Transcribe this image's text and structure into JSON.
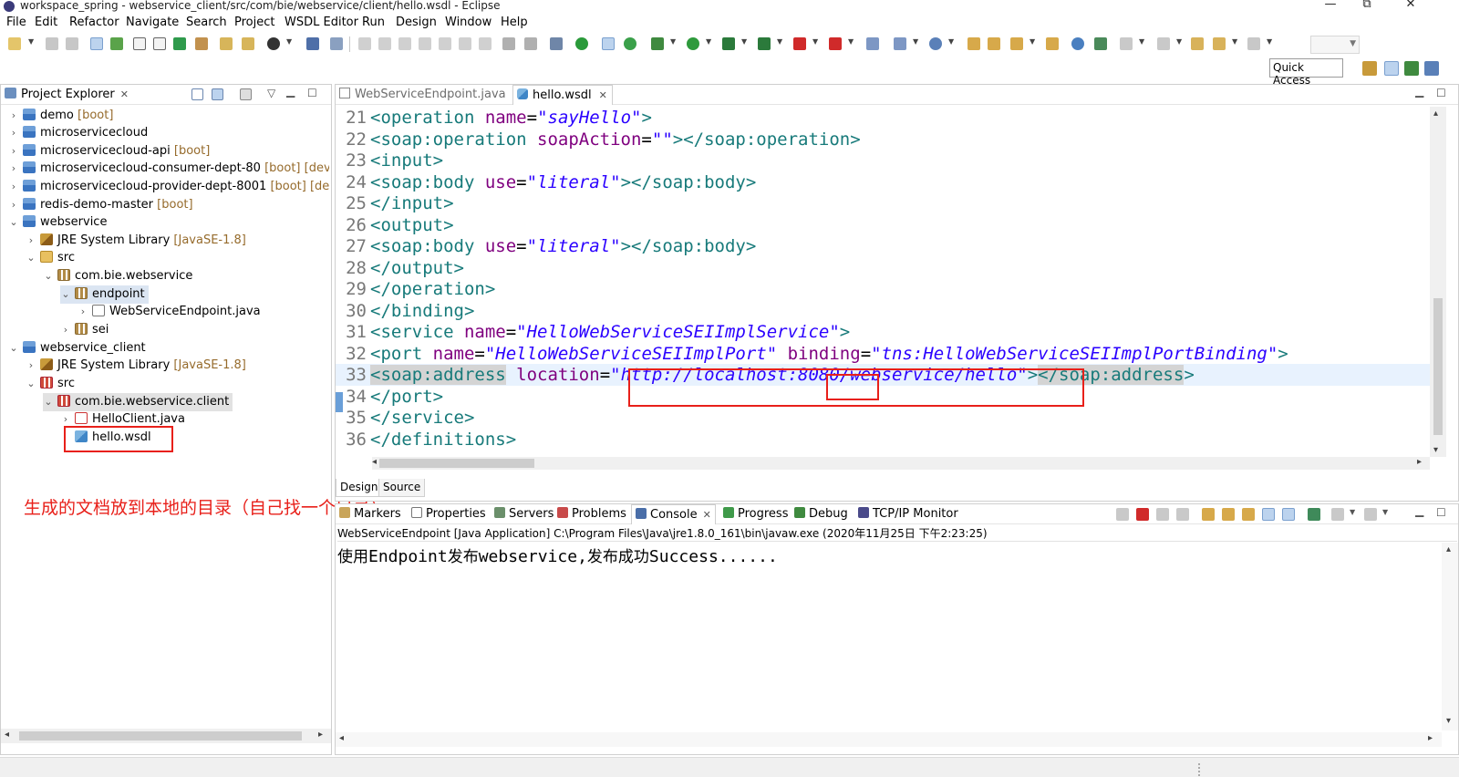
{
  "window": {
    "title": "workspace_spring - webservice_client/src/com/bie/webservice/client/hello.wsdl - Eclipse",
    "controls": {
      "minimize": "—",
      "maximize": "⧉",
      "close": "✕"
    }
  },
  "menu": [
    "File",
    "Edit",
    "Refactor",
    "Navigate",
    "Search",
    "Project",
    "WSDL Editor",
    "Run",
    "Design",
    "Window",
    "Help"
  ],
  "quick_access": {
    "label": "Quick Access"
  },
  "project_explorer": {
    "tab_label": "Project Explorer",
    "close_glyph": "✕",
    "items": [
      {
        "twisty": "›",
        "icon": "project-icon",
        "label": "demo",
        "deco": "[boot]"
      },
      {
        "twisty": "›",
        "icon": "project-icon",
        "label": "microservicecloud",
        "deco": ""
      },
      {
        "twisty": "›",
        "icon": "project-icon",
        "label": "microservicecloud-api",
        "deco": "[boot]"
      },
      {
        "twisty": "›",
        "icon": "project-icon",
        "label": "microservicecloud-consumer-dept-80",
        "deco": "[boot] [devtools]"
      },
      {
        "twisty": "›",
        "icon": "project-icon",
        "label": "microservicecloud-provider-dept-8001",
        "deco": "[boot] [devtools]"
      },
      {
        "twisty": "›",
        "icon": "project-icon",
        "label": "redis-demo-master",
        "deco": "[boot]"
      },
      {
        "twisty": "⌄",
        "icon": "project-icon",
        "label": "webservice",
        "deco": ""
      },
      {
        "twisty": "›",
        "icon": "jre-library-icon",
        "label": "JRE System Library",
        "deco": "[JavaSE-1.8]"
      },
      {
        "twisty": "⌄",
        "icon": "source-folder-icon",
        "label": "src",
        "deco": ""
      },
      {
        "twisty": "⌄",
        "icon": "package-icon",
        "label": "com.bie.webservice",
        "deco": ""
      },
      {
        "twisty": "⌄",
        "icon": "package-icon",
        "label": "endpoint",
        "deco": ""
      },
      {
        "twisty": "›",
        "icon": "java-file-icon",
        "label": "WebServiceEndpoint.java",
        "deco": ""
      },
      {
        "twisty": "›",
        "icon": "package-icon",
        "label": "sei",
        "deco": ""
      },
      {
        "twisty": "⌄",
        "icon": "project-icon",
        "label": "webservice_client",
        "deco": ""
      },
      {
        "twisty": "›",
        "icon": "jre-library-icon",
        "label": "JRE System Library",
        "deco": "[JavaSE-1.8]"
      },
      {
        "twisty": "⌄",
        "icon": "source-folder-icon",
        "label": "src",
        "deco": ""
      },
      {
        "twisty": "⌄",
        "icon": "package-icon",
        "label": "com.bie.webservice.client",
        "deco": ""
      },
      {
        "twisty": "›",
        "icon": "java-file-icon",
        "label": "HelloClient.java",
        "deco": ""
      },
      {
        "twisty": "",
        "icon": "wsdl-file-icon",
        "label": "hello.wsdl",
        "deco": ""
      }
    ]
  },
  "annotation_note": "生成的文档放到本地的目录（自己找一个目录）",
  "editor": {
    "tabs": [
      {
        "label": "WebServiceEndpoint.java",
        "active": false
      },
      {
        "label": "hello.wsdl",
        "active": true
      }
    ],
    "close_glyph": "✕",
    "lines": [
      {
        "n": "21",
        "segs": [
          [
            "t",
            "<operation "
          ],
          [
            "a",
            "name"
          ],
          [
            "p",
            "="
          ],
          [
            "v",
            "\"sayHello\""
          ],
          [
            "t",
            ">"
          ]
        ]
      },
      {
        "n": "22",
        "segs": [
          [
            "t",
            "<soap:operation "
          ],
          [
            "a",
            "soapAction"
          ],
          [
            "p",
            "="
          ],
          [
            "v",
            "\"\""
          ],
          [
            "t",
            "></soap:operation>"
          ]
        ]
      },
      {
        "n": "23",
        "segs": [
          [
            "t",
            "<input>"
          ]
        ]
      },
      {
        "n": "24",
        "segs": [
          [
            "t",
            "<soap:body "
          ],
          [
            "a",
            "use"
          ],
          [
            "p",
            "="
          ],
          [
            "v",
            "\"literal\""
          ],
          [
            "t",
            "></soap:body>"
          ]
        ]
      },
      {
        "n": "25",
        "segs": [
          [
            "t",
            "</input>"
          ]
        ]
      },
      {
        "n": "26",
        "segs": [
          [
            "t",
            "<output>"
          ]
        ]
      },
      {
        "n": "27",
        "segs": [
          [
            "t",
            "<soap:body "
          ],
          [
            "a",
            "use"
          ],
          [
            "p",
            "="
          ],
          [
            "v",
            "\"literal\""
          ],
          [
            "t",
            "></soap:body>"
          ]
        ]
      },
      {
        "n": "28",
        "segs": [
          [
            "t",
            "</output>"
          ]
        ]
      },
      {
        "n": "29",
        "segs": [
          [
            "t",
            "</operation>"
          ]
        ]
      },
      {
        "n": "30",
        "segs": [
          [
            "t",
            "</binding>"
          ]
        ]
      },
      {
        "n": "31",
        "segs": [
          [
            "t",
            "<service "
          ],
          [
            "a",
            "name"
          ],
          [
            "p",
            "="
          ],
          [
            "v",
            "\"HelloWebServiceSEIImplService\""
          ],
          [
            "t",
            ">"
          ]
        ]
      },
      {
        "n": "32",
        "segs": [
          [
            "t",
            "<port "
          ],
          [
            "a",
            "name"
          ],
          [
            "p",
            "="
          ],
          [
            "v",
            "\"HelloWebServiceSEIImplPort\""
          ],
          [
            "p",
            " "
          ],
          [
            "a",
            "binding"
          ],
          [
            "p",
            "="
          ],
          [
            "v",
            "\"tns:HelloWebServiceSEIImplPortBinding\""
          ],
          [
            "t",
            ">"
          ]
        ]
      },
      {
        "n": "33",
        "segs": [
          [
            "h",
            "<soap:address"
          ],
          [
            "p",
            " "
          ],
          [
            "a",
            "location"
          ],
          [
            "p",
            "="
          ],
          [
            "v",
            "\"http://localhost:8080/webservice/hello\""
          ],
          [
            "t",
            ">"
          ],
          [
            "h",
            "</soap:address"
          ],
          [
            "t",
            ">"
          ]
        ]
      },
      {
        "n": "34",
        "segs": [
          [
            "t",
            "</port>"
          ]
        ]
      },
      {
        "n": "35",
        "segs": [
          [
            "t",
            "</service>"
          ]
        ]
      },
      {
        "n": "36",
        "segs": [
          [
            "t",
            "</definitions>"
          ]
        ]
      }
    ],
    "current_line": "33",
    "design_tabs": [
      {
        "label": "Design",
        "active": true
      },
      {
        "label": "Source",
        "active": false
      }
    ]
  },
  "bottom_views": {
    "tabs": [
      {
        "label": "Markers",
        "icon": "markers-icon",
        "active": false
      },
      {
        "label": "Properties",
        "icon": "properties-icon",
        "active": false
      },
      {
        "label": "Servers",
        "icon": "servers-icon",
        "active": false
      },
      {
        "label": "Problems",
        "icon": "problems-icon",
        "active": false
      },
      {
        "label": "Console",
        "icon": "console-icon",
        "active": true
      },
      {
        "label": "Progress",
        "icon": "progress-icon",
        "active": false
      },
      {
        "label": "Debug",
        "icon": "debug-icon",
        "active": false
      },
      {
        "label": "TCP/IP Monitor",
        "icon": "tcpip-monitor-icon",
        "active": false
      }
    ],
    "console": {
      "status": "WebServiceEndpoint [Java Application] C:\\Program Files\\Java\\jre1.8.0_161\\bin\\javaw.exe (2020年11月25日 下午2:23:25)",
      "output_parts": [
        {
          "text": "使用",
          "mono": false
        },
        {
          "text": "Endpoint",
          "mono": true
        },
        {
          "text": "发布",
          "mono": false
        },
        {
          "text": "webservice,",
          "mono": true
        },
        {
          "text": "发布成功",
          "mono": false
        },
        {
          "text": "Success......",
          "mono": true
        }
      ]
    }
  },
  "colors": {
    "accent_red": "#e8201a",
    "xml_tag": "#177a7a",
    "xml_attr": "#7f007f",
    "xml_value": "#2a00ff",
    "current_line_bg": "#e8f2fe"
  }
}
